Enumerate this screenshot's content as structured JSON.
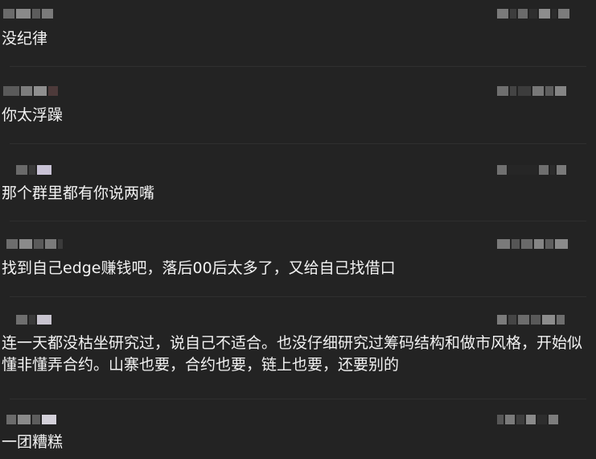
{
  "comments": [
    {
      "text": "没纪律"
    },
    {
      "text": "你太浮躁"
    },
    {
      "text": "那个群里都有你说两嘴"
    },
    {
      "text": "找到自己edge赚钱吧，落后00后太多了，又给自己找借口"
    },
    {
      "text": "连一天都没枯坐研究过，说自己不适合。也没仔细研究过筹码结构和做市风格，开始似懂非懂弄合约。山寨也要，合约也要，链上也要，还要别的"
    },
    {
      "text": "一团糟糕"
    }
  ]
}
